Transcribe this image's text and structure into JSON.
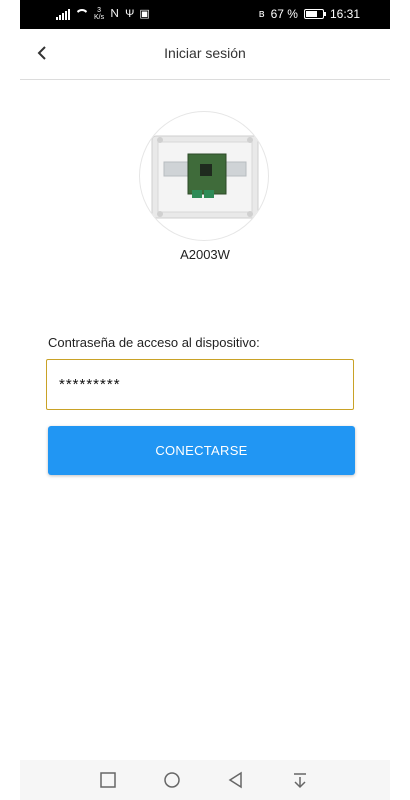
{
  "status_bar": {
    "network_speed_value": "3",
    "network_speed_unit": "K/s",
    "battery_percent": "67 %",
    "battery_level": 0.67,
    "time": "16:31",
    "icons": [
      "signal-icon",
      "wifi-icon",
      "nfc-icon",
      "usb-icon",
      "message-icon",
      "bluetooth-icon",
      "battery-icon"
    ]
  },
  "header": {
    "title": "Iniciar sesión",
    "back_icon": "chevron-left-icon"
  },
  "device": {
    "name": "A2003W",
    "image": "device-photo"
  },
  "form": {
    "password_label": "Contraseña de acceso al dispositivo:",
    "password_value": "*********",
    "accent_color": "#c9a227"
  },
  "actions": {
    "connect_label": "CONECTARSE",
    "connect_color": "#2196f3"
  },
  "nav_bar": {
    "icons": [
      "square-icon",
      "circle-icon",
      "triangle-back-icon",
      "download-icon"
    ]
  }
}
